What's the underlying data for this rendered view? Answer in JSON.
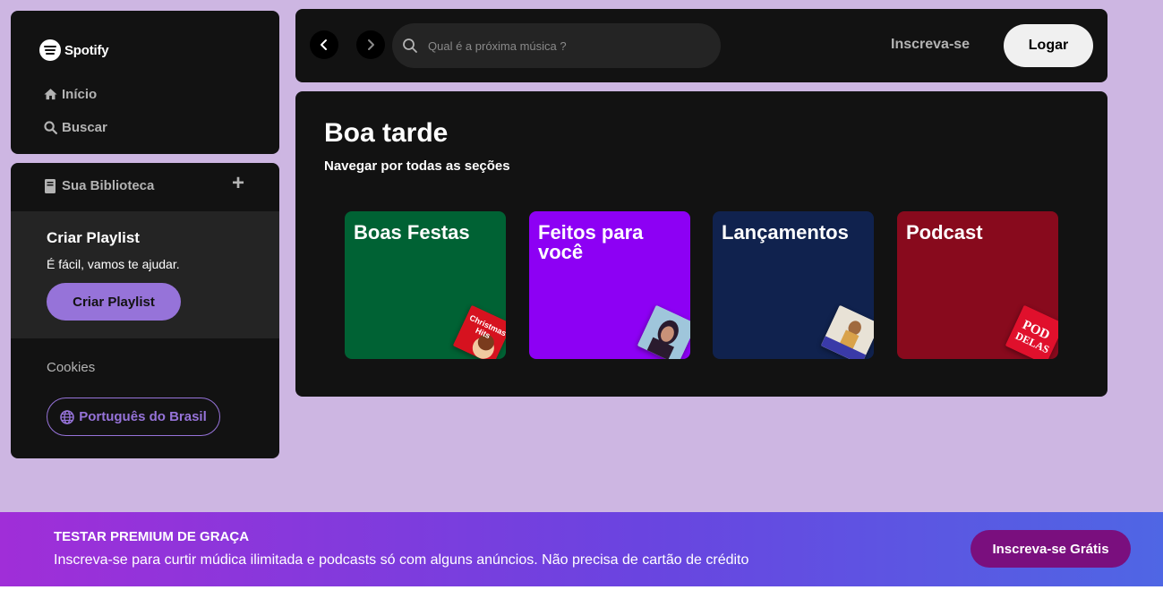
{
  "sidebar": {
    "logo_text": "Spotify",
    "nav": [
      {
        "label": "Início",
        "icon": "home-icon"
      },
      {
        "label": "Buscar",
        "icon": "search-icon"
      }
    ],
    "library": {
      "label": "Sua Biblioteca",
      "icon": "library-icon",
      "add_label": "+"
    },
    "create_playlist": {
      "title": "Criar Playlist",
      "subtitle": "É fácil, vamos te ajudar.",
      "button_label": "Criar Playlist"
    },
    "cookies_label": "Cookies",
    "language_label": "Português do Brasil"
  },
  "topbar": {
    "search_placeholder": "Qual é a próxima música ?",
    "signup_label": "Inscreva-se",
    "login_label": "Logar"
  },
  "main": {
    "greeting": "Boa tarde",
    "section_subtitle": "Navegar por todas as seções",
    "cards": [
      {
        "title": "Boas Festas",
        "color": "#006234",
        "art_label": "Christmas Hits"
      },
      {
        "title": "Feitos para você",
        "color": "#8d00f4",
        "art_label": ""
      },
      {
        "title": "Lançamentos",
        "color": "#10224e",
        "art_label": ""
      },
      {
        "title": "Podcast",
        "color": "#880a1d",
        "art_label": "POD DELAS"
      }
    ]
  },
  "premium_banner": {
    "title": "TESTAR PREMIUM DE GRAÇA",
    "subtitle": "Inscreva-se para curtir múdica ilimitada e podcasts só com alguns anúncios. Não precisa de cartão de crédito",
    "button_label": "Inscreva-se Grátis"
  },
  "colors": {
    "background": "#cdb6e2",
    "panel": "#121212",
    "accent": "#9673d9",
    "premium_button": "#7a0f7e"
  }
}
